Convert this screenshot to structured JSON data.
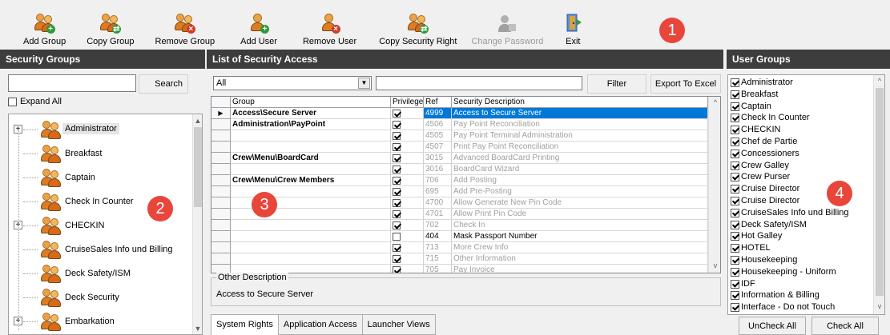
{
  "toolbar": {
    "buttons": [
      {
        "label": "Add Group",
        "icon": "add-group-icon"
      },
      {
        "label": "Copy Group",
        "icon": "copy-group-icon"
      },
      {
        "label": "Remove Group",
        "icon": "remove-group-icon"
      },
      {
        "label": "Add User",
        "icon": "add-user-icon"
      },
      {
        "label": "Remove User",
        "icon": "remove-user-icon"
      },
      {
        "label": "Copy Security Right",
        "icon": "copy-security-right-icon"
      },
      {
        "label": "Change Password",
        "icon": "change-password-icon",
        "disabled": true
      },
      {
        "label": "Exit",
        "icon": "exit-door-icon"
      }
    ]
  },
  "callouts": [
    "1",
    "2",
    "3",
    "4"
  ],
  "colors": {
    "callout": "#e8463a",
    "header": "#3d3d3d",
    "selection": "#0078d7"
  },
  "security_groups": {
    "title": "Security Groups",
    "search_value": "",
    "search_label": "Search",
    "expand_all_label": "Expand All",
    "expand_all_checked": false,
    "items": [
      {
        "label": "Administrator",
        "expandable": true
      },
      {
        "label": "Breakfast",
        "expandable": false
      },
      {
        "label": "Captain",
        "expandable": false
      },
      {
        "label": "Check In Counter",
        "expandable": false
      },
      {
        "label": "CHECKIN",
        "expandable": true
      },
      {
        "label": "CruiseSales Info und Billing",
        "expandable": false
      },
      {
        "label": "Deck Safety/ISM",
        "expandable": false
      },
      {
        "label": "Deck Security",
        "expandable": false
      },
      {
        "label": "Embarkation",
        "expandable": true
      }
    ]
  },
  "access_list": {
    "title": "List of Security Access",
    "combo_value": "All",
    "filter_value": "",
    "filter_label": "Filter",
    "export_label": "Export To Excel",
    "columns": [
      "Group",
      "Privilege",
      "Ref",
      "Security Description"
    ],
    "rows": [
      {
        "group": "Access\\Secure Server",
        "privilege": true,
        "ref": "4999",
        "desc": "Access to Secure Server",
        "enabled": true,
        "selected": true
      },
      {
        "group": "Administration\\PayPoint",
        "privilege": true,
        "ref": "4506",
        "desc": "Pay Point Reconciliation",
        "enabled": false
      },
      {
        "group": "",
        "privilege": true,
        "ref": "4505",
        "desc": "Pay Point Terminal Administration",
        "enabled": false
      },
      {
        "group": "",
        "privilege": true,
        "ref": "4507",
        "desc": "Print Pay Point Reconciliation",
        "enabled": false
      },
      {
        "group": "Crew\\Menu\\BoardCard",
        "privilege": true,
        "ref": "3015",
        "desc": "Advanced BoardCard Printing",
        "enabled": false
      },
      {
        "group": "",
        "privilege": true,
        "ref": "3016",
        "desc": "BoardCard Wizard",
        "enabled": false
      },
      {
        "group": "Crew\\Menu\\Crew Members",
        "privilege": true,
        "ref": "706",
        "desc": "Add Posting",
        "enabled": false
      },
      {
        "group": "",
        "privilege": true,
        "ref": "695",
        "desc": "Add Pre-Posting",
        "enabled": false
      },
      {
        "group": "",
        "privilege": true,
        "ref": "4700",
        "desc": "Allow Generate New Pin Code",
        "enabled": false
      },
      {
        "group": "",
        "privilege": true,
        "ref": "4701",
        "desc": "Allow Print Pin Code",
        "enabled": false
      },
      {
        "group": "",
        "privilege": true,
        "ref": "702",
        "desc": "Check In",
        "enabled": false
      },
      {
        "group": "",
        "privilege": false,
        "ref": "404",
        "desc": "Mask Passport Number",
        "enabled": true
      },
      {
        "group": "",
        "privilege": true,
        "ref": "713",
        "desc": "More Crew Info",
        "enabled": false
      },
      {
        "group": "",
        "privilege": true,
        "ref": "715",
        "desc": "Other Information",
        "enabled": false
      },
      {
        "group": "",
        "privilege": true,
        "ref": "705",
        "desc": "Pay Invoice",
        "enabled": false
      }
    ],
    "other_description_label": "Other Description",
    "other_description_value": "Access to Secure Server",
    "tabs": [
      "System Rights",
      "Application Access",
      "Launcher Views"
    ]
  },
  "user_groups": {
    "title": "User Groups",
    "items": [
      "Administrator",
      "Breakfast",
      "Captain",
      "Check In Counter",
      "CHECKIN",
      "Chef de Partie",
      "Concessioners",
      "Crew Galley",
      "Crew Purser",
      "Cruise Director",
      "Cruise Director",
      "CruiseSales Info und Billing",
      "Deck Safety/ISM",
      "Hot Galley",
      "HOTEL",
      "Housekeeping",
      "Housekeeping - Uniform",
      "IDF",
      "Information & Billing",
      "Interface - Do not Touch"
    ],
    "uncheck_all_label": "UnCheck All",
    "check_all_label": "Check All"
  }
}
